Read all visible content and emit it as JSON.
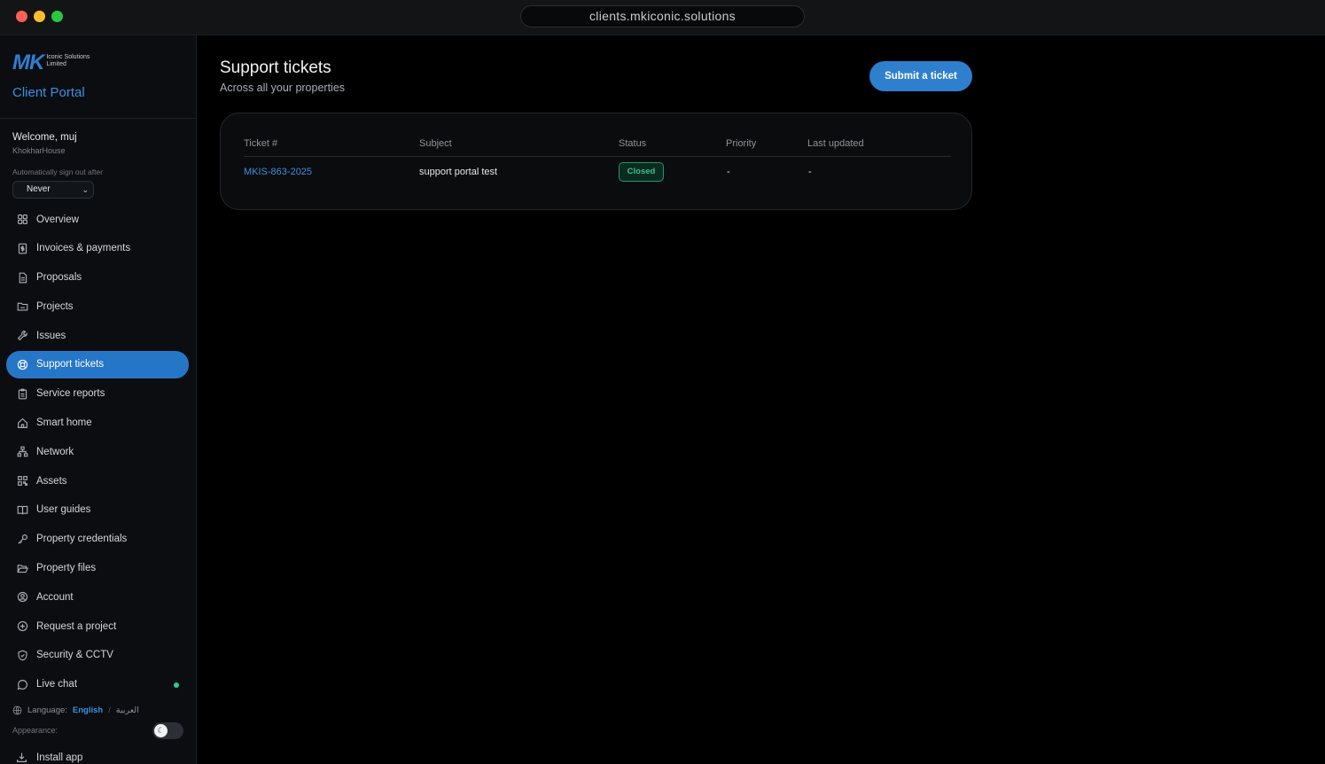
{
  "window": {
    "url": "clients.mkiconic.solutions"
  },
  "brand": {
    "logo_mark": "MK",
    "logo_line1": "Iconic Solutions",
    "logo_line2": "Limited",
    "portal_title": "Client Portal",
    "accent_color": "#2f7fcf"
  },
  "user": {
    "welcome": "Welcome, muj",
    "property": "KhokharHouse",
    "auto_signout_label": "Automatically sign out after",
    "auto_signout_value": "Never"
  },
  "nav": [
    {
      "label": "Overview",
      "icon": "grid-icon",
      "active": false
    },
    {
      "label": "Invoices & payments",
      "icon": "invoice-icon",
      "active": false
    },
    {
      "label": "Proposals",
      "icon": "document-icon",
      "active": false
    },
    {
      "label": "Projects",
      "icon": "folder-icon",
      "active": false
    },
    {
      "label": "Issues",
      "icon": "wrench-icon",
      "active": false
    },
    {
      "label": "Support tickets",
      "icon": "lifebuoy-icon",
      "active": true
    },
    {
      "label": "Service reports",
      "icon": "clipboard-icon",
      "active": false
    },
    {
      "label": "Smart home",
      "icon": "home-icon",
      "active": false
    },
    {
      "label": "Network",
      "icon": "network-icon",
      "active": false
    },
    {
      "label": "Assets",
      "icon": "qr-icon",
      "active": false
    },
    {
      "label": "User guides",
      "icon": "book-icon",
      "active": false
    },
    {
      "label": "Property credentials",
      "icon": "key-icon",
      "active": false
    },
    {
      "label": "Property files",
      "icon": "folder-open-icon",
      "active": false
    },
    {
      "label": "Account",
      "icon": "user-circle-icon",
      "active": false
    },
    {
      "label": "Request a project",
      "icon": "plus-circle-icon",
      "active": false
    },
    {
      "label": "Security & CCTV",
      "icon": "shield-icon",
      "active": false
    },
    {
      "label": "Live chat",
      "icon": "chat-icon",
      "active": false
    }
  ],
  "language": {
    "label": "Language:",
    "english": "English",
    "separator": "/",
    "arabic": "العربية"
  },
  "appearance_label": "Appearance:",
  "install_label": "Install app",
  "main": {
    "title": "Support tickets",
    "subtitle": "Across all your properties",
    "submit_label": "Submit a ticket",
    "table": {
      "columns": [
        "Ticket #",
        "Subject",
        "Status",
        "Priority",
        "Last updated"
      ],
      "rows": [
        {
          "ticket": "MKIS-863-2025",
          "subject": "support portal test",
          "status": "Closed",
          "priority": "-",
          "updated": "-"
        }
      ]
    }
  }
}
